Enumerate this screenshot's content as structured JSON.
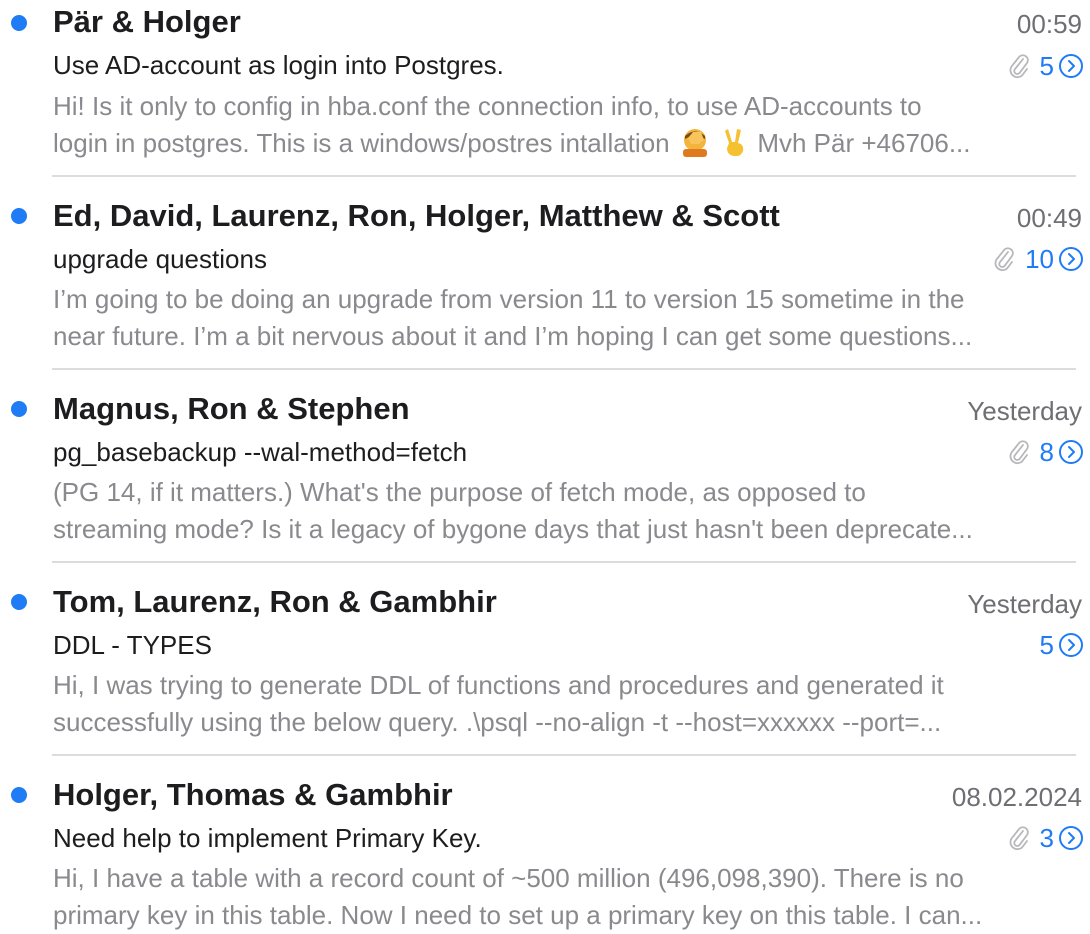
{
  "messages": [
    {
      "sender": "Pär & Holger",
      "date": "00:59",
      "subject": "Use AD-account as login into Postgres.",
      "has_attachment": true,
      "count": "5",
      "preview_line1": "Hi! Is it only to config in hba.conf the connection info, to use AD-accounts to",
      "preview_line2_a": "login in postgres. This is a windows/postres intallation",
      "preview_line2_b": "Mvh Pär +46706...",
      "emojis": [
        "facepalm-emoji",
        "victory-hand-emoji"
      ]
    },
    {
      "sender": "Ed, David, Laurenz, Ron, Holger, Matthew & Scott",
      "date": "00:49",
      "subject": "upgrade questions",
      "has_attachment": true,
      "count": "10",
      "preview_line1": "I’m going to be doing an upgrade from version 11 to version 15 sometime in the",
      "preview_line2": "near future. I’m a bit nervous about it and I’m hoping I can get some questions..."
    },
    {
      "sender": "Magnus, Ron & Stephen",
      "date": "Yesterday",
      "subject": "pg_basebackup --wal-method=fetch",
      "has_attachment": true,
      "count": "8",
      "preview_line1": "(PG 14, if it matters.) What's the purpose of fetch mode, as opposed to",
      "preview_line2": "streaming mode?  Is it a legacy of bygone days that just hasn't been deprecate..."
    },
    {
      "sender": "Tom, Laurenz, Ron & Gambhir",
      "date": "Yesterday",
      "subject": "DDL - TYPES",
      "has_attachment": false,
      "count": "5",
      "preview_line1": "Hi,  I was trying to generate DDL of functions and procedures and generated it",
      "preview_line2": "successfully using the below query. .\\psql --no-align -t --host=xxxxxx --port=..."
    },
    {
      "sender": "Holger, Thomas & Gambhir",
      "date": "08.02.2024",
      "subject": "Need help to implement Primary Key.",
      "has_attachment": true,
      "count": "3",
      "preview_line1": "Hi, I have a table with a record count of ~500 million (496,098,390). There is no",
      "preview_line2": "primary key in this table. Now I need to set up a primary key on this table. I can..."
    }
  ],
  "colors": {
    "unread_dot": "#1f7cf5",
    "accent": "#1f7cf5",
    "sender": "#1d1d1f",
    "secondary": "#6e6e73",
    "preview": "#8a8a8e",
    "separator": "#dcdcdc"
  },
  "icons": {
    "unread": "unread-dot-icon",
    "attachment": "paperclip-icon",
    "thread": "chevron-right-circle-icon"
  }
}
